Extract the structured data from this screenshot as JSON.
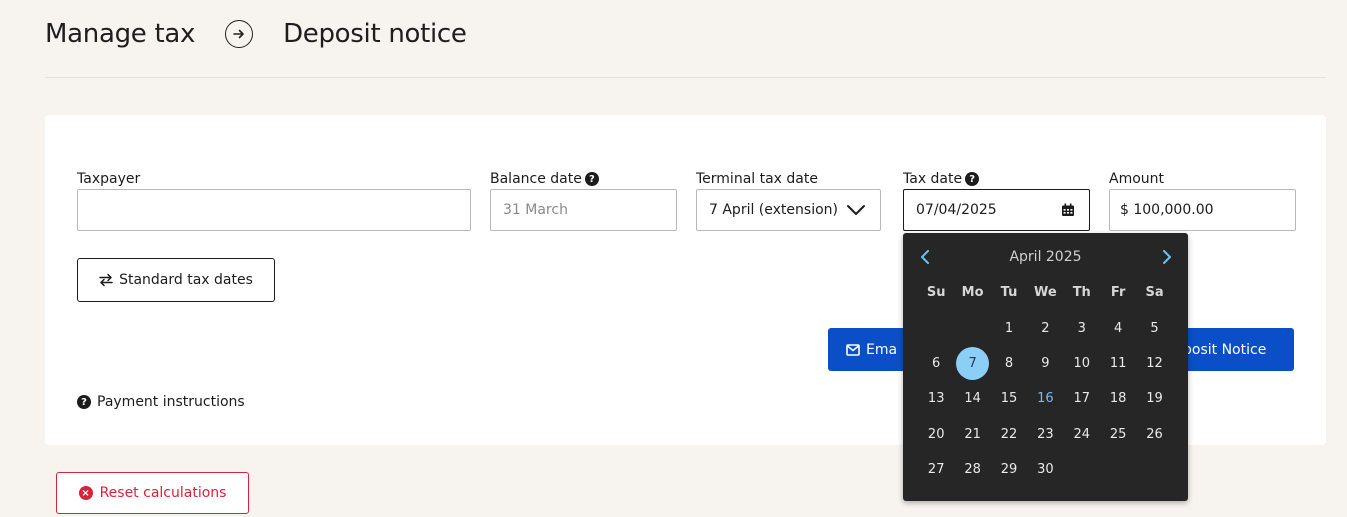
{
  "header": {
    "crumb_1": "Manage tax",
    "crumb_2": "Deposit notice"
  },
  "form": {
    "taxpayer_label": "Taxpayer",
    "taxpayer_value": "",
    "balance_date_label": "Balance date",
    "balance_date_value": "31 March",
    "terminal_tax_date_label": "Terminal tax date",
    "terminal_tax_date_value": "7 April (extension)",
    "tax_date_label": "Tax date",
    "tax_date_value": "07/04/2025",
    "amount_label": "Amount",
    "amount_value": "$ 100,000.00"
  },
  "buttons": {
    "standard_tax_dates": "Standard tax dates",
    "email_partial": "Ema",
    "deposit_notice_partial": "posit Notice",
    "payment_instructions": "Payment instructions",
    "reset_calculations": "Reset calculations"
  },
  "calendar": {
    "month_label": "April 2025",
    "weekdays": [
      "Su",
      "Mo",
      "Tu",
      "We",
      "Th",
      "Fr",
      "Sa"
    ],
    "leading_blanks": 2,
    "days": [
      "1",
      "2",
      "3",
      "4",
      "5",
      "6",
      "7",
      "8",
      "9",
      "10",
      "11",
      "12",
      "13",
      "14",
      "15",
      "16",
      "17",
      "18",
      "19",
      "20",
      "21",
      "22",
      "23",
      "24",
      "25",
      "26",
      "27",
      "28",
      "29",
      "30"
    ],
    "selected_day": "7",
    "today_day": "16"
  },
  "colors": {
    "primary": "#0a4fc8",
    "danger": "#d7233b",
    "calendar_bg": "#262626",
    "selected_day": "#8ccff6",
    "today": "#6cc0f5"
  }
}
